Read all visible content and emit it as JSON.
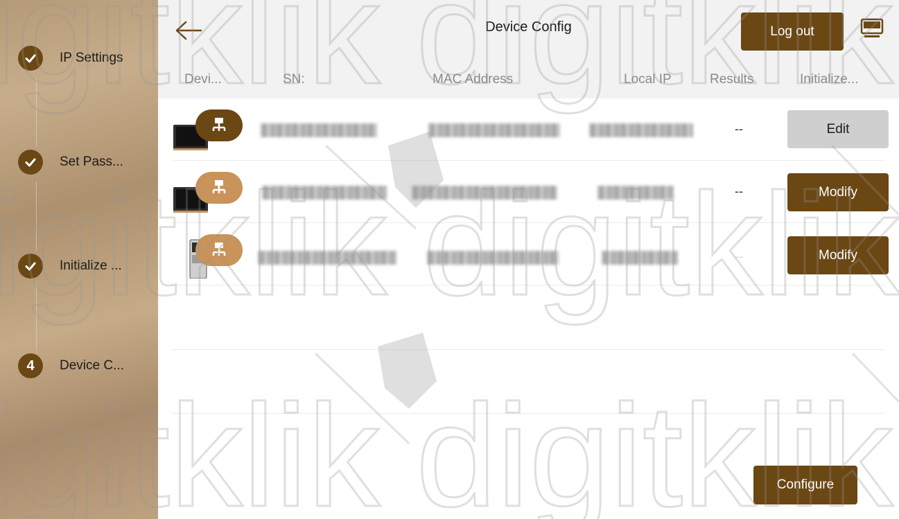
{
  "sidebar": {
    "steps": [
      {
        "label": "IP Settings",
        "number": "1",
        "done": true
      },
      {
        "label": "Set Pass...",
        "number": "2",
        "done": true
      },
      {
        "label": "Initialize ...",
        "number": "3",
        "done": true
      },
      {
        "label": "Device C...",
        "number": "4",
        "done": false
      }
    ]
  },
  "header": {
    "title": "Device Config",
    "logout_label": "Log out",
    "back_icon": "arrow-left-icon",
    "display_icon": "display-icon"
  },
  "table": {
    "columns": [
      "Devi...",
      "SN:",
      "MAC Address",
      "Local IP",
      "Results",
      "Initialize..."
    ],
    "rows": [
      {
        "result": "--",
        "action": "Edit",
        "device": "indoor-monitor",
        "network_badge": "network-icon"
      },
      {
        "result": "--",
        "action": "Modify",
        "device": "indoor-monitor",
        "network_badge": "network-icon"
      },
      {
        "result": "--",
        "action": "Modify",
        "device": "door-station",
        "network_badge": "network-icon"
      }
    ]
  },
  "footer": {
    "configure_label": "Configure"
  },
  "watermark": {
    "text": "digitklik"
  },
  "colors": {
    "accent": "#6b4714",
    "badge_light": "#c9935a",
    "header_bg": "#f2f2f2",
    "edit_bg": "#cfcfcf"
  }
}
